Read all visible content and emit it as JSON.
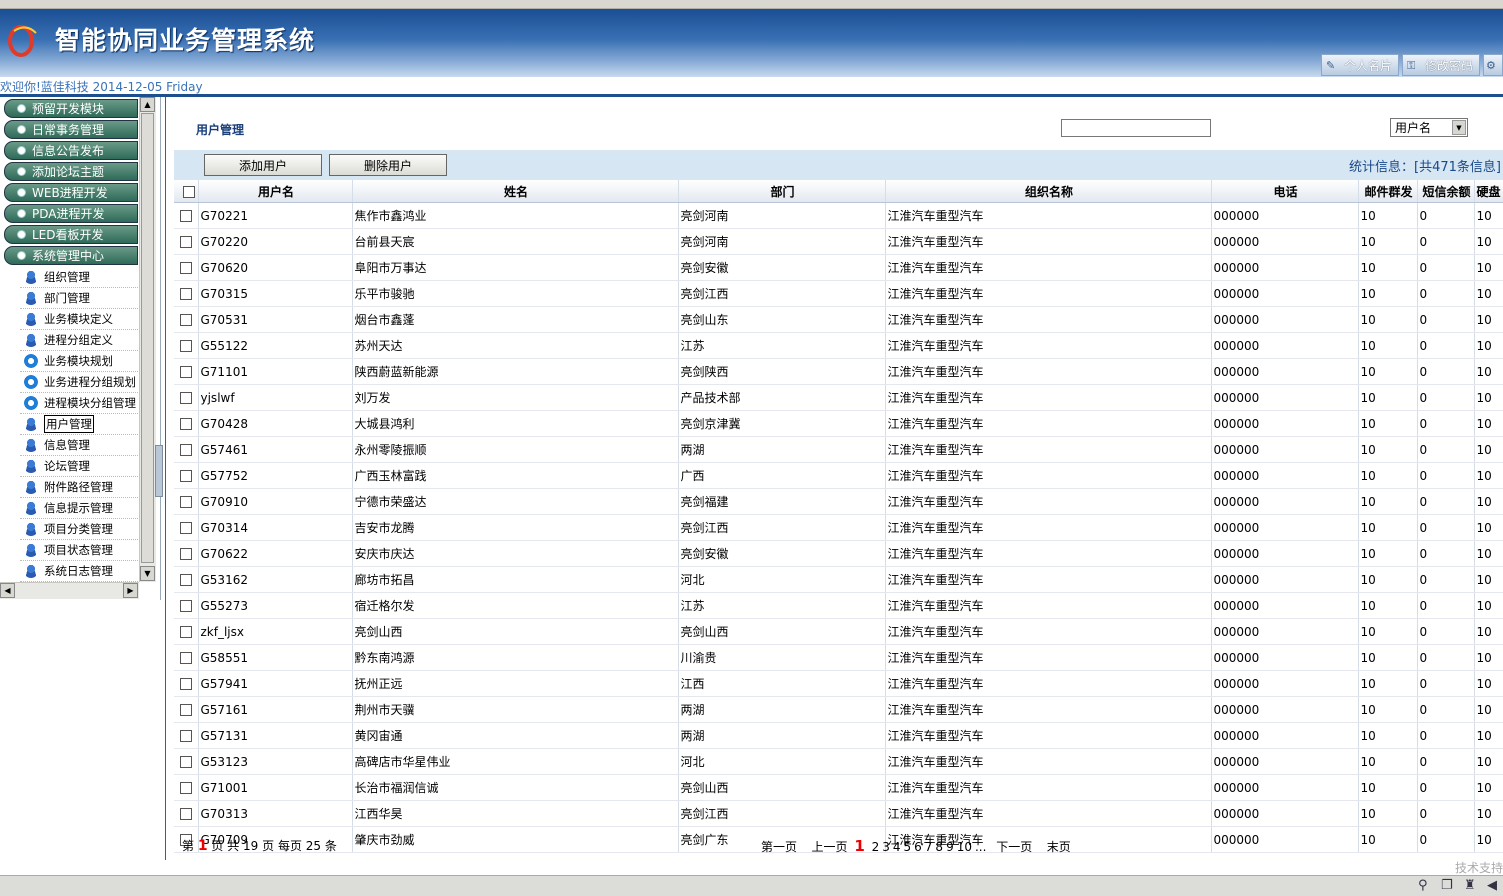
{
  "app": {
    "title": "智能协同业务管理系统",
    "welcome": "欢迎你!蓝佳科技 2014-12-05 Friday",
    "header_buttons": [
      {
        "label": "个人名片",
        "icon": "pen-icon"
      },
      {
        "label": "修改密码",
        "icon": "key-icon"
      }
    ]
  },
  "sidebar": {
    "menus": [
      "预留开发模块",
      "日常事务管理",
      "信息公告发布",
      "添加论坛主题",
      "WEB进程开发",
      "PDA进程开发",
      "LED看板开发",
      "系统管理中心"
    ],
    "sub_items": [
      {
        "label": "组织管理",
        "icon": "user-icon"
      },
      {
        "label": "部门管理",
        "icon": "user-icon"
      },
      {
        "label": "业务模块定义",
        "icon": "user-icon"
      },
      {
        "label": "进程分组定义",
        "icon": "user-icon"
      },
      {
        "label": "业务模块规划",
        "icon": "ie-icon"
      },
      {
        "label": "业务进程分组规划",
        "icon": "ie-icon"
      },
      {
        "label": "进程模块分组管理",
        "icon": "ie-icon"
      },
      {
        "label": "用户管理",
        "icon": "user-icon",
        "selected": true
      },
      {
        "label": "信息管理",
        "icon": "user-icon"
      },
      {
        "label": "论坛管理",
        "icon": "user-icon"
      },
      {
        "label": "附件路径管理",
        "icon": "user-icon"
      },
      {
        "label": "信息提示管理",
        "icon": "user-icon"
      },
      {
        "label": "项目分类管理",
        "icon": "user-icon"
      },
      {
        "label": "项目状态管理",
        "icon": "user-icon"
      },
      {
        "label": "系统日志管理",
        "icon": "user-icon"
      }
    ]
  },
  "main": {
    "heading": "用户管理",
    "search_value": "",
    "search_field": "用户名",
    "add_button": "添加用户",
    "delete_button": "删除用户",
    "stats": "统计信息：[共471条信息]",
    "columns": [
      "用户名",
      "姓名",
      "部门",
      "组织名称",
      "电话",
      "邮件群发",
      "短信余额",
      "硬盘"
    ],
    "rows": [
      [
        "G70221",
        "焦作市鑫鸿业",
        "亮剑河南",
        "江淮汽车重型汽车",
        "000000",
        "10",
        "0",
        "10"
      ],
      [
        "G70220",
        "台前县天宸",
        "亮剑河南",
        "江淮汽车重型汽车",
        "000000",
        "10",
        "0",
        "10"
      ],
      [
        "G70620",
        "阜阳市万事达",
        "亮剑安徽",
        "江淮汽车重型汽车",
        "000000",
        "10",
        "0",
        "10"
      ],
      [
        "G70315",
        "乐平市骏驰",
        "亮剑江西",
        "江淮汽车重型汽车",
        "000000",
        "10",
        "0",
        "10"
      ],
      [
        "G70531",
        "烟台市鑫蓬",
        "亮剑山东",
        "江淮汽车重型汽车",
        "000000",
        "10",
        "0",
        "10"
      ],
      [
        "G55122",
        "苏州天达",
        "江苏",
        "江淮汽车重型汽车",
        "000000",
        "10",
        "0",
        "10"
      ],
      [
        "G71101",
        "陕西蔚蓝新能源",
        "亮剑陕西",
        "江淮汽车重型汽车",
        "000000",
        "10",
        "0",
        "10"
      ],
      [
        "yjslwf",
        "刘万发",
        "产品技术部",
        "江淮汽车重型汽车",
        "000000",
        "10",
        "0",
        "10"
      ],
      [
        "G70428",
        "大城县鸿利",
        "亮剑京津冀",
        "江淮汽车重型汽车",
        "000000",
        "10",
        "0",
        "10"
      ],
      [
        "G57461",
        "永州零陵振顺",
        "两湖",
        "江淮汽车重型汽车",
        "000000",
        "10",
        "0",
        "10"
      ],
      [
        "G57752",
        "广西玉林富践",
        "广西",
        "江淮汽车重型汽车",
        "000000",
        "10",
        "0",
        "10"
      ],
      [
        "G70910",
        "宁德市荣盛达",
        "亮剑福建",
        "江淮汽车重型汽车",
        "000000",
        "10",
        "0",
        "10"
      ],
      [
        "G70314",
        "吉安市龙腾",
        "亮剑江西",
        "江淮汽车重型汽车",
        "000000",
        "10",
        "0",
        "10"
      ],
      [
        "G70622",
        "安庆市庆达",
        "亮剑安徽",
        "江淮汽车重型汽车",
        "000000",
        "10",
        "0",
        "10"
      ],
      [
        "G53162",
        "廊坊市拓昌",
        "河北",
        "江淮汽车重型汽车",
        "000000",
        "10",
        "0",
        "10"
      ],
      [
        "G55273",
        "宿迁格尔发",
        "江苏",
        "江淮汽车重型汽车",
        "000000",
        "10",
        "0",
        "10"
      ],
      [
        "zkf_ljsx",
        "亮剑山西",
        "亮剑山西",
        "江淮汽车重型汽车",
        "000000",
        "10",
        "0",
        "10"
      ],
      [
        "G58551",
        "黔东南鸿源",
        "川渝贵",
        "江淮汽车重型汽车",
        "000000",
        "10",
        "0",
        "10"
      ],
      [
        "G57941",
        "抚州正远",
        "江西",
        "江淮汽车重型汽车",
        "000000",
        "10",
        "0",
        "10"
      ],
      [
        "G57161",
        "荆州市天骥",
        "两湖",
        "江淮汽车重型汽车",
        "000000",
        "10",
        "0",
        "10"
      ],
      [
        "G57131",
        "黄冈宙通",
        "两湖",
        "江淮汽车重型汽车",
        "000000",
        "10",
        "0",
        "10"
      ],
      [
        "G53123",
        "高碑店市华星伟业",
        "河北",
        "江淮汽车重型汽车",
        "000000",
        "10",
        "0",
        "10"
      ],
      [
        "G71001",
        "长治市福润信诚",
        "亮剑山西",
        "江淮汽车重型汽车",
        "000000",
        "10",
        "0",
        "10"
      ],
      [
        "G70313",
        "江西华昊",
        "亮剑江西",
        "江淮汽车重型汽车",
        "000000",
        "10",
        "0",
        "10"
      ],
      [
        "G70709",
        "肇庆市劲威",
        "亮剑广东",
        "江淮汽车重型汽车",
        "000000",
        "10",
        "0",
        "10"
      ]
    ],
    "pager_left": {
      "prefix": "第",
      "current": "1",
      "mid": "页 共 19 页 每页 25 条"
    },
    "pager_right": {
      "first": "第一页",
      "prev": "上一页",
      "current": "1",
      "pages": [
        "2",
        "3",
        "4",
        "5",
        "6",
        "7",
        "8",
        "9",
        "10",
        "..."
      ],
      "next": "下一页",
      "last": "末页"
    }
  },
  "footer": {
    "text": "技术支持"
  },
  "colors": {
    "header_blue": "#1b4e94",
    "menu_green": "#2f6a58",
    "toolbar_bg": "#d6e6f3",
    "page_current": "#ee0000"
  }
}
